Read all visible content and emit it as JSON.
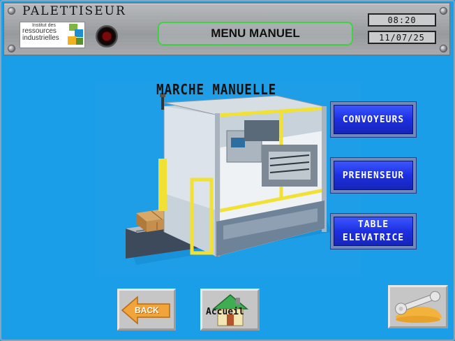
{
  "header": {
    "app_title": "PALETTISEUR",
    "logo_lines": [
      "Institut des",
      "ressources",
      "industrielles"
    ],
    "menu_title": "MENU MANUEL",
    "time": "08:20",
    "date": "11/07/25"
  },
  "main": {
    "picture_title": "MARCHE MANUELLE"
  },
  "nav_buttons": [
    {
      "label": "CONVOYEURS"
    },
    {
      "label": "PREHENSEUR"
    },
    {
      "label": "TABLE\nELEVATRICE"
    }
  ],
  "footer": {
    "back_label": "BACK",
    "home_label": "Accueil"
  },
  "colors": {
    "background": "#1a9ee8",
    "nav_button": "#1d2fe0",
    "menu_frame": "#3fd43f"
  },
  "icons": [
    "status-led-icon",
    "back-arrow-icon",
    "home-house-icon",
    "settings-wrench-icon",
    "institute-logo"
  ]
}
